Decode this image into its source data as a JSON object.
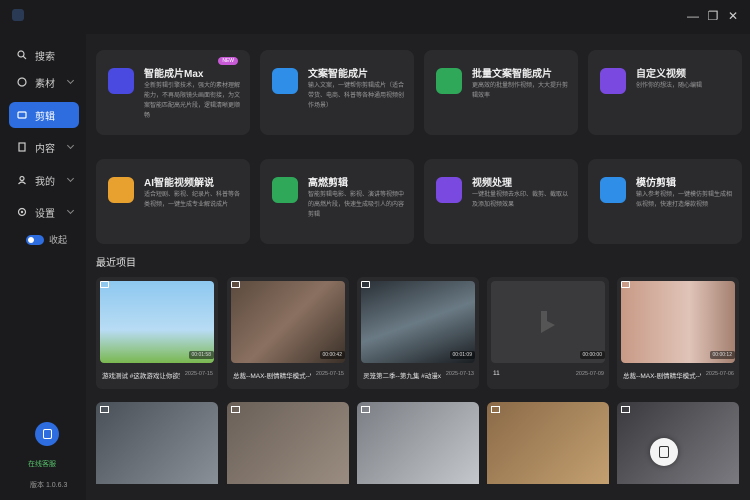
{
  "sidebar": {
    "items": [
      {
        "label": "搜索"
      },
      {
        "label": "素材"
      },
      {
        "label": "剪辑"
      },
      {
        "label": "内容"
      },
      {
        "label": "我的"
      },
      {
        "label": "设置"
      }
    ],
    "collapse_label": "收起",
    "online_text": "在线客服",
    "version": "版本 1.0.6.3"
  },
  "tools": [
    {
      "title": "智能成片Max",
      "desc": "全新剪辑引擎技术，强大的素材理解能力，不再局限镜头画面衔接，为文案智能匹配高光片段，逻辑清晰更顺畅",
      "badge": "NEW"
    },
    {
      "title": "文案智能成片",
      "desc": "输入文案，一键帮你剪辑成片（适合带货、电商、科普等各种通用视频创作场景）"
    },
    {
      "title": "批量文案智能成片",
      "desc": "更高效的批量制作视频，大大提升剪辑效率"
    },
    {
      "title": "自定义视频",
      "desc": "创作你的想法，随心编辑"
    },
    {
      "title": "AI智能视频解说",
      "desc": "适合短剧、影视、纪录片、科普等各类视频，一键生成专业解说成片"
    },
    {
      "title": "高燃剪辑",
      "desc": "智能剪辑电影、影视、演讲等视频中的高燃片段，快速生成吸引人的内容剪辑"
    },
    {
      "title": "视频处理",
      "desc": "一键批量视频去水印、裁剪、截取以及添加视频效果"
    },
    {
      "title": "模仿剪辑",
      "desc": "输入参考视频，一键模仿剪辑生成相似视频，快速打造爆款视频"
    }
  ],
  "recent": {
    "title": "最近项目",
    "projects": [
      {
        "name": "游戏测试 #这款游戏让你欲罢不能",
        "date": "2025-07-15",
        "duration": "00:01:58"
      },
      {
        "name": "总裁--MAX-剧情精华模式--V2",
        "date": "2025-07-15",
        "duration": "00:00:42"
      },
      {
        "name": "灵笼第二季--第九集 #动漫x",
        "date": "2025-07-13",
        "duration": "00:01:09"
      },
      {
        "name": "11",
        "date": "2025-07-09",
        "duration": "00:00:00"
      },
      {
        "name": "总裁--MAX-剧情精华模式--V1",
        "date": "2025-07-06",
        "duration": "00:00:12"
      }
    ]
  },
  "colors": {
    "accent": "#2d6de0",
    "new_badge": "#c85ad8",
    "online": "#55c06a"
  }
}
